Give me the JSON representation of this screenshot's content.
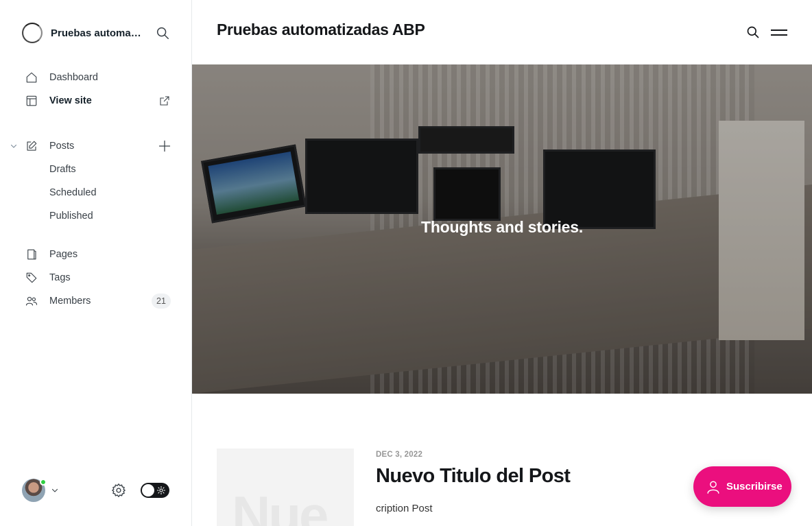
{
  "sidebar": {
    "site_name": "Pruebas automatizadas ABP",
    "nav_primary": [
      {
        "label": "Dashboard",
        "icon": "home-icon"
      },
      {
        "label": "View site",
        "icon": "layout-icon"
      }
    ],
    "posts": {
      "label": "Posts",
      "icon": "edit-icon",
      "sub_items": [
        {
          "label": "Drafts"
        },
        {
          "label": "Scheduled"
        },
        {
          "label": "Published"
        }
      ]
    },
    "nav_secondary": [
      {
        "label": "Pages",
        "icon": "page-icon"
      },
      {
        "label": "Tags",
        "icon": "tag-icon"
      },
      {
        "label": "Members",
        "icon": "members-icon",
        "badge": "21"
      }
    ],
    "user_status_color": "#30cf43"
  },
  "site": {
    "title": "Pruebas automatizadas ABP",
    "hero_text": "Thoughts and stories."
  },
  "post": {
    "date": "DEC 3, 2022",
    "title": "Nuevo Titulo del Post",
    "excerpt": "cription Post",
    "thumb_text": "Nue"
  },
  "subscribe": {
    "label": "Suscribirse",
    "color": "#eb0f7e"
  }
}
